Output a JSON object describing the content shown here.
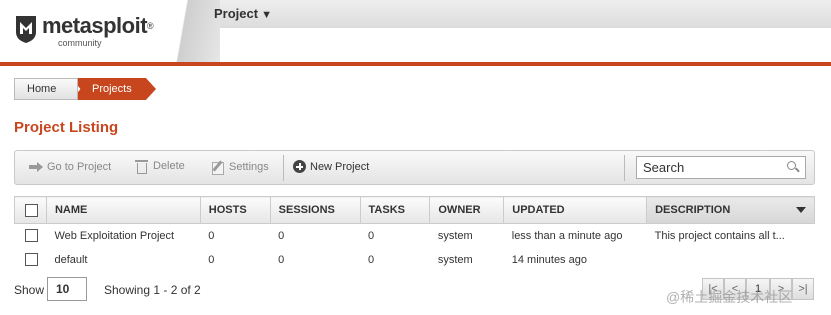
{
  "header": {
    "logo_text": "metasploit",
    "logo_reg": "®",
    "logo_sub": "community",
    "project_menu": "Project",
    "project_menu_caret": "▼"
  },
  "breadcrumb": {
    "home": "Home",
    "current": "Projects"
  },
  "page_title": "Project Listing",
  "toolbar": {
    "go_to_project": "Go to Project",
    "delete": "Delete",
    "settings": "Settings",
    "new_project": "New Project",
    "search_placeholder": "Search"
  },
  "table": {
    "columns": [
      "NAME",
      "HOSTS",
      "SESSIONS",
      "TASKS",
      "OWNER",
      "UPDATED",
      "DESCRIPTION"
    ],
    "rows": [
      {
        "name": "Web Exploitation Project",
        "hosts": "0",
        "sessions": "0",
        "tasks": "0",
        "owner": "system",
        "updated": "less than a minute ago",
        "description": "This project contains all t..."
      },
      {
        "name": "default",
        "hosts": "0",
        "sessions": "0",
        "tasks": "0",
        "owner": "system",
        "updated": "14 minutes ago",
        "description": ""
      }
    ]
  },
  "footer": {
    "show_label": "Show",
    "show_value": "10",
    "showing": "Showing 1 - 2 of 2",
    "pager": {
      "first": "|<",
      "prev": "<",
      "page": "1",
      "next": ">",
      "last": ">|"
    }
  },
  "watermark": "@稀土掘金技术社区",
  "colors": {
    "accent": "#c8461e"
  }
}
